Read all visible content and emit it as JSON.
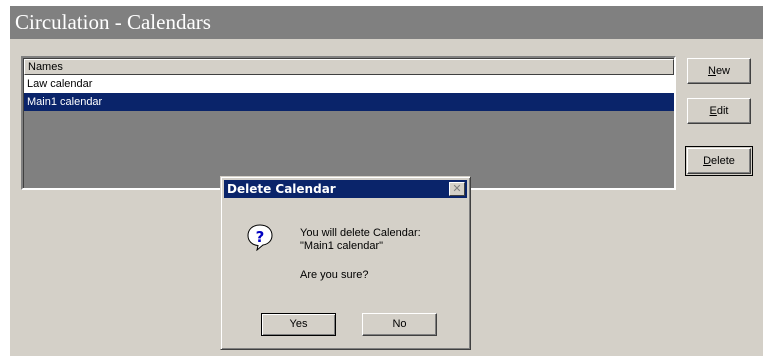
{
  "window": {
    "title": "Circulation - Calendars"
  },
  "list": {
    "header": "Names",
    "rows": [
      "Law calendar",
      "Main1 calendar"
    ],
    "selected_index": 1
  },
  "buttons": {
    "new": {
      "accel": "N",
      "rest": "ew"
    },
    "edit": {
      "accel": "E",
      "rest": "dit"
    },
    "delete": {
      "accel": "D",
      "rest": "elete"
    }
  },
  "dialog": {
    "title": "Delete Calendar",
    "close_glyph": "✕",
    "icon": "question-icon",
    "message_line1": "You will delete  Calendar:",
    "message_line2": "\"Main1 calendar\"",
    "question": "Are you sure?",
    "yes_label": "Yes",
    "no_label": "No"
  },
  "colors": {
    "face": "#d4d0c8",
    "selection": "#0a246a",
    "title_bar": "#808080"
  }
}
